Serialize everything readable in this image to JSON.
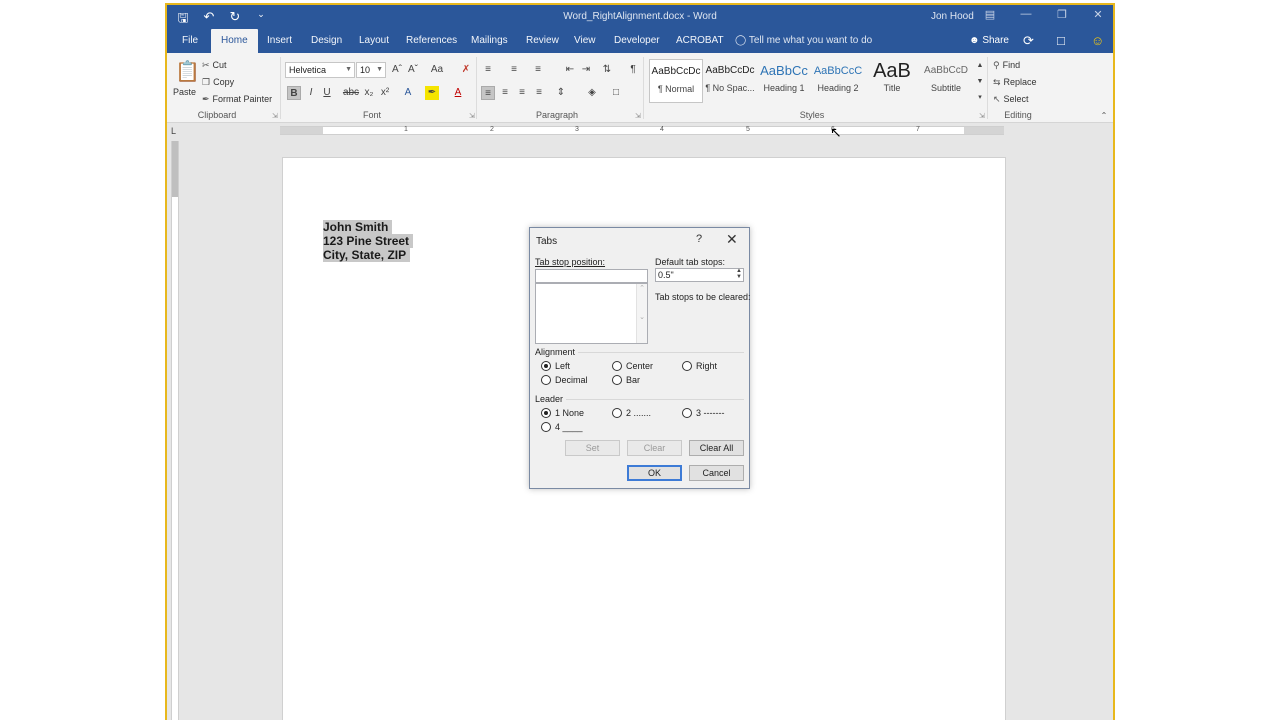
{
  "titlebar": {
    "document_title": "Word_RightAlignment.docx - Word",
    "user": "Jon Hood"
  },
  "ribbon_tabs": [
    "File",
    "Home",
    "Insert",
    "Design",
    "Layout",
    "References",
    "Mailings",
    "Review",
    "View",
    "Developer",
    "ACROBAT"
  ],
  "active_tab": "Home",
  "tell_me": "Tell me what you want to do",
  "share_label": "Share",
  "clipboard": {
    "paste": "Paste",
    "cut": "Cut",
    "copy": "Copy",
    "format_painter": "Format Painter",
    "group_label": "Clipboard"
  },
  "font": {
    "name": "Helvetica",
    "size": "10",
    "group_label": "Font"
  },
  "paragraph": {
    "group_label": "Paragraph"
  },
  "styles": {
    "group_label": "Styles",
    "items": [
      {
        "preview": "AaBbCcDc",
        "name": "¶ Normal"
      },
      {
        "preview": "AaBbCcDc",
        "name": "¶ No Spac..."
      },
      {
        "preview": "AaBbCc",
        "name": "Heading 1"
      },
      {
        "preview": "AaBbCcC",
        "name": "Heading 2"
      },
      {
        "preview": "AaB",
        "name": "Title"
      },
      {
        "preview": "AaBbCcD",
        "name": "Subtitle"
      }
    ]
  },
  "editing": {
    "group_label": "Editing",
    "find": "Find",
    "replace": "Replace",
    "select": "Select"
  },
  "ruler_numbers": [
    "1",
    "2",
    "3",
    "4",
    "5",
    "6",
    "7"
  ],
  "document": {
    "lines": [
      "John Smith",
      "123 Pine Street",
      "City, State, ZIP"
    ]
  },
  "dialog": {
    "title": "Tabs",
    "help": "?",
    "tab_stop_position_label": "Tab stop position:",
    "tab_stop_position_value": "",
    "default_tab_stops_label": "Default tab stops:",
    "default_tab_stops_value": "0.5\"",
    "to_be_cleared_label": "Tab stops to be cleared:",
    "alignment_label": "Alignment",
    "alignment_options": [
      "Left",
      "Center",
      "Right",
      "Decimal",
      "Bar"
    ],
    "alignment_selected": "Left",
    "leader_label": "Leader",
    "leader_options": [
      "1 None",
      "2 .......",
      "3 -------",
      "4 ____"
    ],
    "leader_selected": "1 None",
    "buttons": {
      "set": "Set",
      "clear": "Clear",
      "clear_all": "Clear All",
      "ok": "OK",
      "cancel": "Cancel"
    }
  }
}
